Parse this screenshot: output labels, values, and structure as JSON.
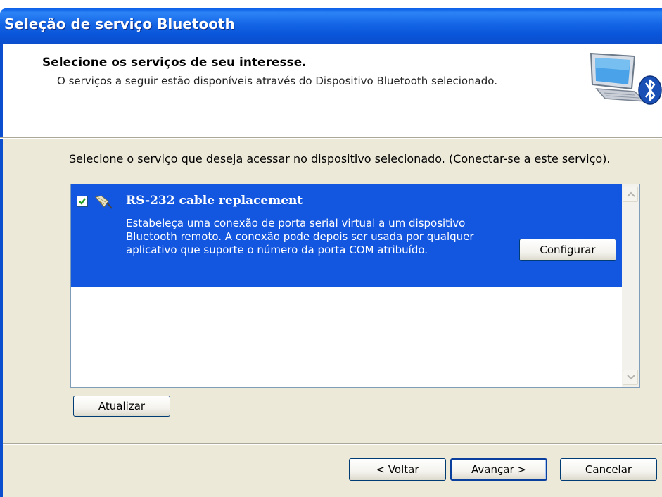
{
  "window": {
    "title": "Seleção de serviço Bluetooth"
  },
  "header": {
    "title": "Selecione os serviços de seu interesse.",
    "description": "O serviços a seguir estão disponíveis através do Dispositivo Bluetooth selecionado.",
    "icon": "bluetooth-computer-icon"
  },
  "body": {
    "instruction": "Selecione o serviço que deseja acessar no dispositivo selecionado. (Conectar-se a este serviço).",
    "services": [
      {
        "name": "RS-232 cable replacement",
        "description": "Estabeleça uma conexão de porta serial virtual a um dispositivo Bluetooth remoto. A conexão pode depois ser usada por qualquer aplicativo que suporte o número da porta COM atribuído.",
        "checked": true,
        "selected": true,
        "configure_label": "Configurar",
        "icon": "serial-cable-icon"
      }
    ],
    "refresh_label": "Atualizar"
  },
  "footer": {
    "back_label": "< Voltar",
    "next_label": "Avançar >",
    "cancel_label": "Cancelar"
  },
  "colors": {
    "title_bar": "#0b55d9",
    "selection": "#1356e0",
    "dialog_bg": "#ece9d8"
  }
}
